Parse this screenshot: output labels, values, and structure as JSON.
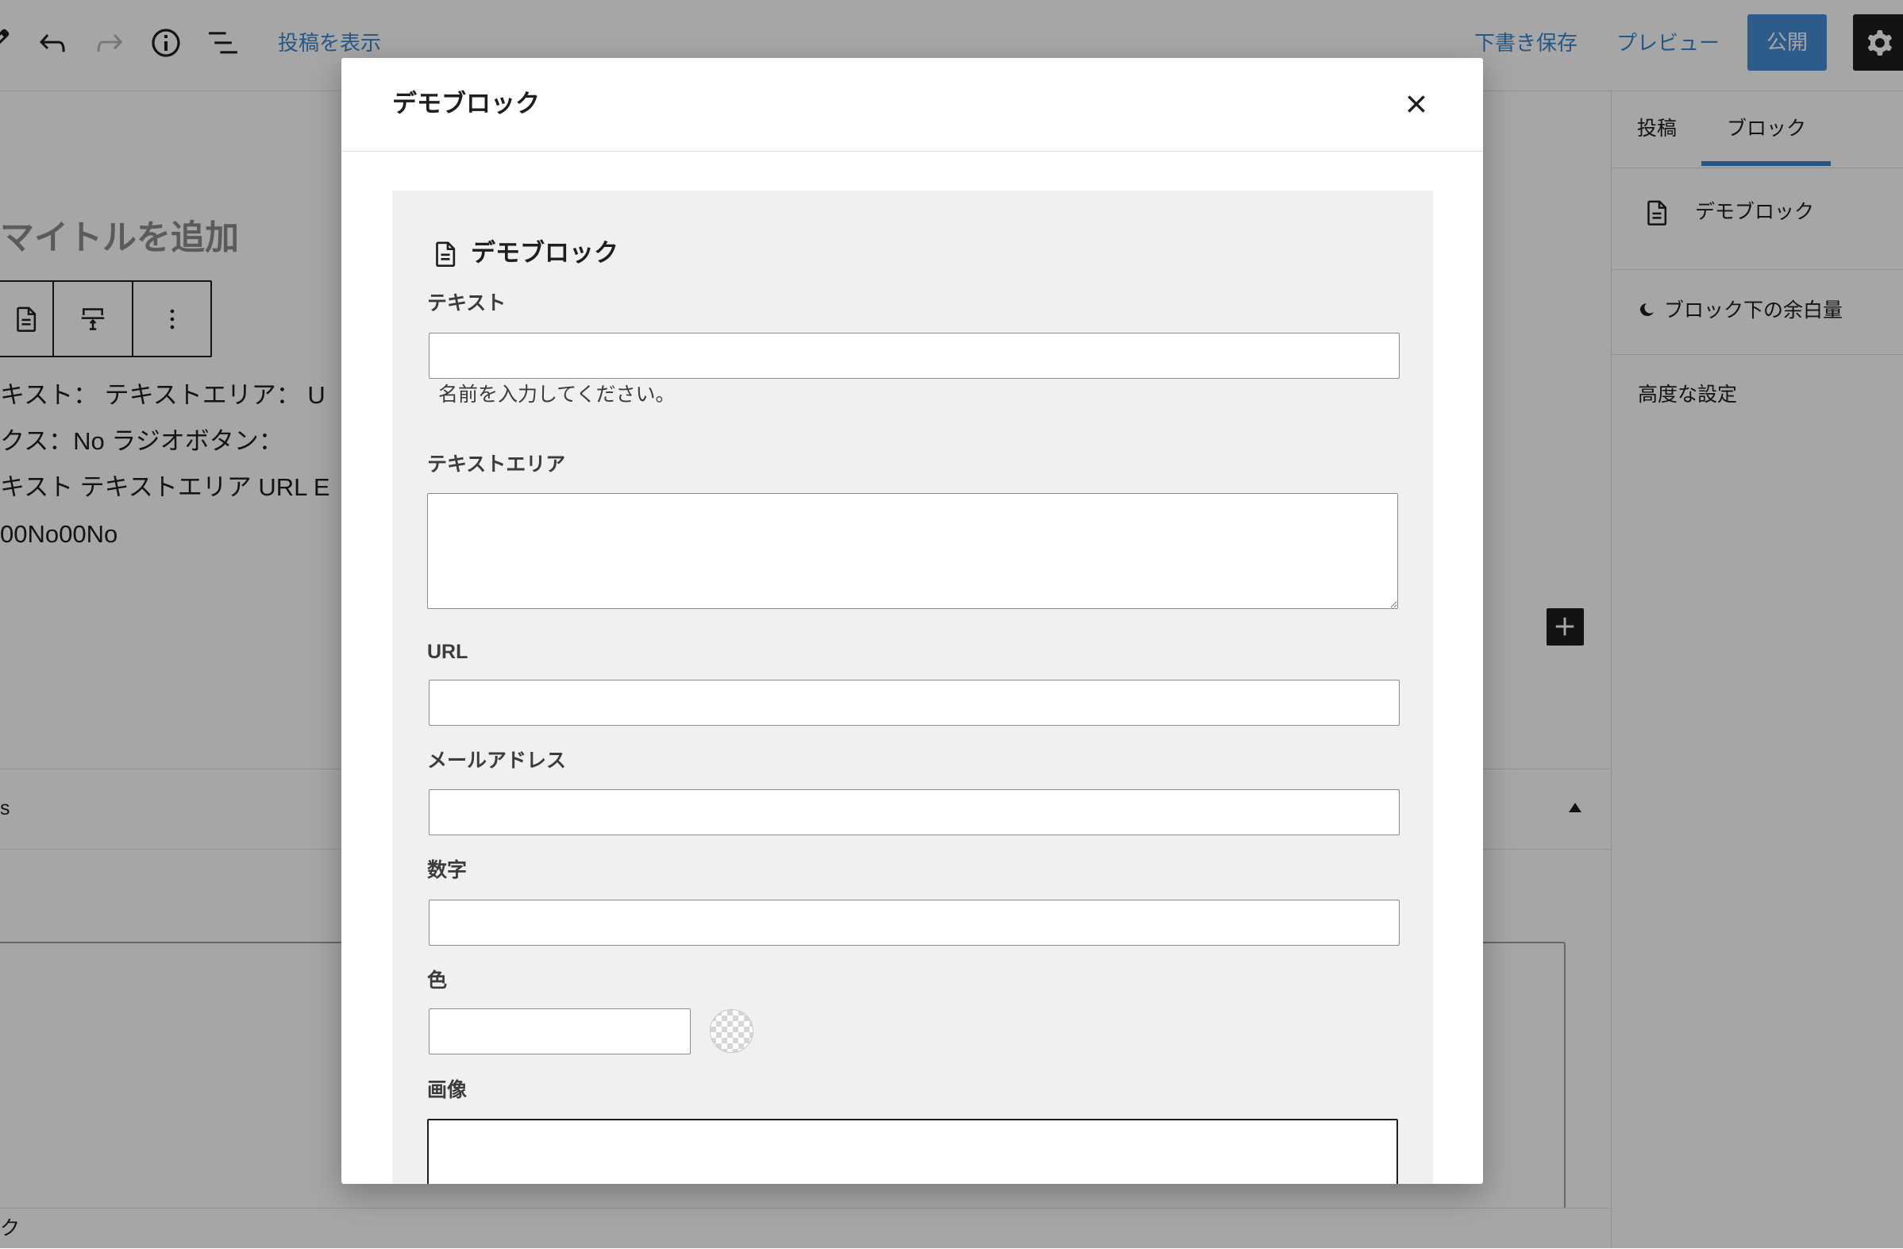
{
  "header": {
    "view_post_link": "投稿を表示",
    "save_draft_label": "下書き保存",
    "preview_label": "プレビュー",
    "publish_label": "公開",
    "icons": [
      "pencil-icon",
      "undo-icon",
      "redo-icon",
      "info-icon",
      "list-view-icon",
      "gear-icon"
    ]
  },
  "editor": {
    "title_placeholder": "マイトルを追加",
    "block_toolbar_icons": [
      "document-icon",
      "spacing-icon",
      "more-vertical-icon"
    ],
    "content_lines": [
      "キスト： テキストエリア： U",
      "クス：No ラジオボタン：",
      "キスト テキストエリア URL E",
      "00No00No"
    ],
    "meta_panel_label": "s",
    "status_bar_text": "ク"
  },
  "sidebar": {
    "tabs": [
      {
        "label": "投稿",
        "active": false
      },
      {
        "label": "ブロック",
        "active": true
      }
    ],
    "block_card_name": "デモブロック",
    "panels": [
      {
        "label": "ブロック下の余白量"
      },
      {
        "label": "高度な設定"
      }
    ]
  },
  "modal": {
    "title": "デモブロック",
    "block_title": "デモブロック",
    "fields": {
      "text": {
        "label": "テキスト",
        "help": "名前を入力してください。"
      },
      "textarea": {
        "label": "テキストエリア"
      },
      "url": {
        "label": "URL"
      },
      "email": {
        "label": "メールアドレス"
      },
      "number": {
        "label": "数字"
      },
      "color": {
        "label": "色"
      },
      "image": {
        "label": "画像"
      }
    }
  },
  "colors": {
    "accent": "#3a86d0",
    "text": "#1e1e1e",
    "overlay": "rgba(0,0,0,0.35)",
    "modal_panel": "#f0f0f0",
    "input_border": "#8c8c8c"
  }
}
